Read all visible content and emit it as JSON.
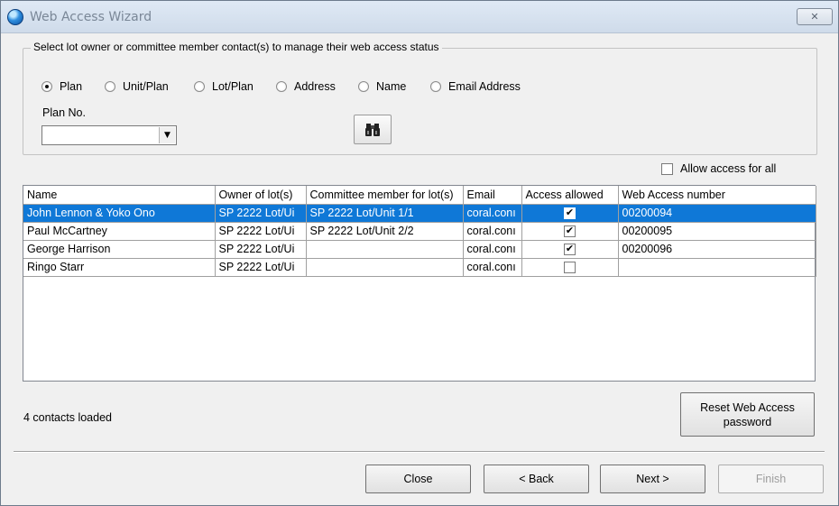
{
  "window": {
    "title": "Web Access Wizard",
    "close_glyph": "✕"
  },
  "group": {
    "legend": "Select lot owner or committee member contact(s) to manage their web access status",
    "radios": [
      {
        "label": "Plan",
        "checked": true
      },
      {
        "label": "Unit/Plan",
        "checked": false
      },
      {
        "label": "Lot/Plan",
        "checked": false
      },
      {
        "label": "Address",
        "checked": false
      },
      {
        "label": "Name",
        "checked": false
      },
      {
        "label": "Email Address",
        "checked": false
      }
    ],
    "plan_label": "Plan No.",
    "plan_value": "",
    "search_icon": "binoculars-icon"
  },
  "allow_all": {
    "label": "Allow access for all",
    "checked": false
  },
  "grid": {
    "columns": [
      "Name",
      "Owner of lot(s)",
      "Committee member for lot(s)",
      "Email",
      "Access allowed",
      "Web Access number"
    ],
    "rows": [
      {
        "name": "John Lennon & Yoko Ono",
        "owner": "SP 2222 Lot/Ui",
        "committee": "SP 2222 Lot/Unit 1/1",
        "email": "coral.conı",
        "access": true,
        "number": "00200094",
        "selected": true
      },
      {
        "name": "Paul McCartney",
        "owner": "SP 2222 Lot/Ui",
        "committee": "SP 2222 Lot/Unit 2/2",
        "email": "coral.conı",
        "access": true,
        "number": "00200095",
        "selected": false
      },
      {
        "name": "George Harrison",
        "owner": "SP 2222 Lot/Ui",
        "committee": "",
        "email": "coral.conı",
        "access": true,
        "number": "00200096",
        "selected": false
      },
      {
        "name": "Ringo Starr",
        "owner": "SP 2222 Lot/Ui",
        "committee": "",
        "email": "coral.conı",
        "access": false,
        "number": "",
        "selected": false
      }
    ]
  },
  "status_text": "4 contacts loaded",
  "buttons": {
    "reset": "Reset Web Access password",
    "close": "Close",
    "back": "< Back",
    "next": "Next >",
    "finish": "Finish"
  },
  "colors": {
    "selection": "#0f78d7",
    "title_text": "#7a8797"
  }
}
